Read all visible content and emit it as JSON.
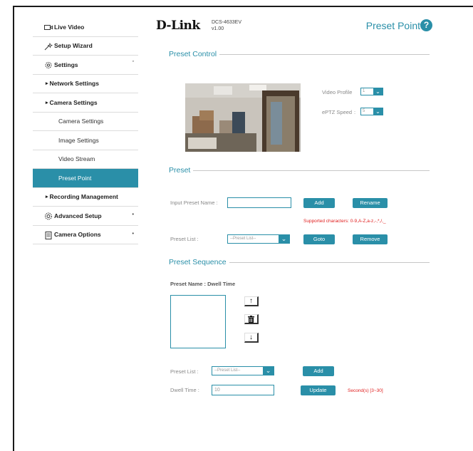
{
  "sidebar": {
    "items": [
      {
        "label": "Live Video",
        "icon": "video-icon"
      },
      {
        "label": "Setup Wizard",
        "icon": "wizard-icon"
      },
      {
        "label": "Settings",
        "icon": "gear-icon",
        "arrow": "ˇ"
      },
      {
        "label": "Network Settings"
      },
      {
        "label": "Camera Settings"
      },
      {
        "label": "Camera Settings"
      },
      {
        "label": "Image Settings"
      },
      {
        "label": "Video Stream"
      },
      {
        "label": "Preset Point"
      },
      {
        "label": "Recording Management"
      },
      {
        "label": "Advanced Setup",
        "icon": "advanced-gear-icon",
        "arrow": "•"
      },
      {
        "label": "Camera Options",
        "icon": "document-icon",
        "arrow": "•"
      }
    ],
    "bullet": "▸"
  },
  "header": {
    "logo": "D-Link",
    "model": "DCS-4633EV",
    "version": "v1.00",
    "title": "Preset Point",
    "help": "?"
  },
  "preset_control": {
    "title": "Preset Control",
    "video_profile_label": "Video Profile",
    "video_profile_value": "1",
    "eptz_speed_label": "ePTZ Speed",
    "eptz_speed_value": "5"
  },
  "preset": {
    "title": "Preset",
    "input_label": "Input Preset Name :",
    "add_label": "Add",
    "rename_label": "Rename",
    "supported": "Supported characters: 0-9,A-Z,a-z,-,*,/,_",
    "list_label": "Preset List :",
    "list_value": "--Preset List--",
    "goto_label": "Goto",
    "remove_label": "Remove"
  },
  "preset_sequence": {
    "title": "Preset Sequence",
    "column_heading": "Preset Name : Dwell Time",
    "up_icon": "↑",
    "delete_icon": "🗑",
    "down_icon": "↓",
    "list_label": "Preset List :",
    "list_value": "--Preset List--",
    "add_label": "Add",
    "dwell_label": "Dwell Time :",
    "dwell_value": "10",
    "update_label": "Update",
    "dwell_hint": "Second(s) [3~30]"
  },
  "colors": {
    "accent": "#2a8fa8",
    "warning": "#e02020"
  }
}
